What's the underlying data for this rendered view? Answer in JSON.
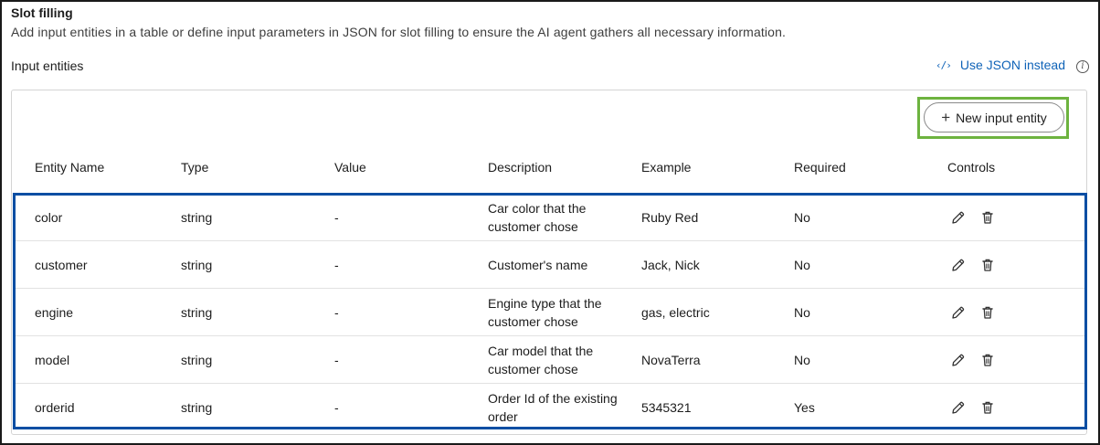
{
  "header": {
    "title": "Slot filling",
    "description": "Add input entities in a table or define input parameters in JSON for slot filling to ensure the AI agent gathers all necessary information."
  },
  "input_entities": {
    "label": "Input entities",
    "json_link": {
      "icon": "code-icon",
      "label": "Use JSON instead"
    },
    "info_icon": "info-icon",
    "new_button": {
      "icon": "plus-icon",
      "label": "New input entity"
    },
    "columns": [
      "Entity Name",
      "Type",
      "Value",
      "Description",
      "Example",
      "Required",
      "Controls"
    ],
    "rows": [
      {
        "name": "color",
        "type": "string",
        "value": "-",
        "description": "Car color that the customer chose",
        "example": "Ruby Red",
        "required": "No"
      },
      {
        "name": "customer",
        "type": "string",
        "value": "-",
        "description": "Customer's name",
        "example": "Jack, Nick",
        "required": "No"
      },
      {
        "name": "engine",
        "type": "string",
        "value": "-",
        "description": "Engine type that the customer chose",
        "example": "gas, electric",
        "required": "No"
      },
      {
        "name": "model",
        "type": "string",
        "value": "-",
        "description": "Car model that the customer chose",
        "example": "NovaTerra",
        "required": "No"
      },
      {
        "name": "orderid",
        "type": "string",
        "value": "-",
        "description": "Order Id of the existing order",
        "example": "5345321",
        "required": "Yes"
      }
    ],
    "controls": {
      "edit_icon": "pencil-icon",
      "delete_icon": "trash-icon"
    }
  },
  "colors": {
    "link": "#0f63b8",
    "highlight_green": "#6db33f",
    "highlight_blue": "#0a4ea3"
  }
}
